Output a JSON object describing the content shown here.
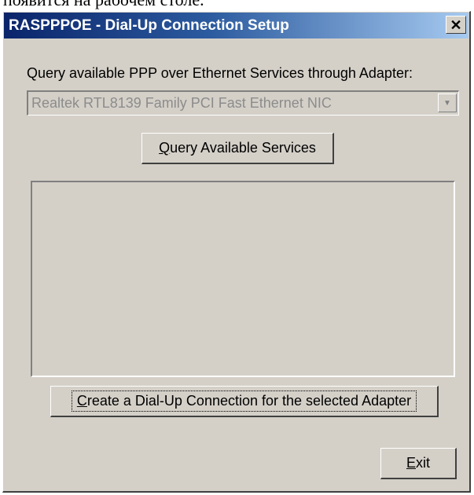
{
  "background_text": "появится на рабочем столе.",
  "window": {
    "title": "RASPPPOE - Dial-Up Connection Setup",
    "close_glyph": "✕"
  },
  "query_label": "Query available PPP over Ethernet Services through Adapter:",
  "adapter_select": {
    "value": "Realtek RTL8139 Family PCI Fast Ethernet NIC",
    "arrow_glyph": "▼"
  },
  "query_button": {
    "mnemonic": "Q",
    "rest": "uery Available Services"
  },
  "services_list": {
    "items": []
  },
  "create_button": {
    "mnemonic": "C",
    "rest": "reate a Dial-Up Connection for the selected Adapter"
  },
  "exit_button": {
    "mnemonic": "E",
    "rest": "xit"
  },
  "colors": {
    "title_bar_start": "#0a246a",
    "title_bar_end": "#a6caf0",
    "window_face": "#d4d0c8"
  }
}
